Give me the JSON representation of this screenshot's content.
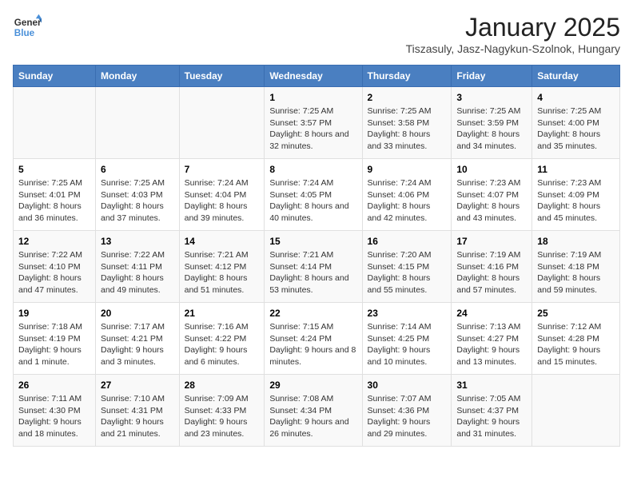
{
  "header": {
    "logo_line1": "General",
    "logo_line2": "Blue",
    "title": "January 2025",
    "subtitle": "Tiszasuly, Jasz-Nagykun-Szolnok, Hungary"
  },
  "days_of_week": [
    "Sunday",
    "Monday",
    "Tuesday",
    "Wednesday",
    "Thursday",
    "Friday",
    "Saturday"
  ],
  "weeks": [
    [
      {
        "day": "",
        "detail": ""
      },
      {
        "day": "",
        "detail": ""
      },
      {
        "day": "",
        "detail": ""
      },
      {
        "day": "1",
        "detail": "Sunrise: 7:25 AM\nSunset: 3:57 PM\nDaylight: 8 hours\nand 32 minutes."
      },
      {
        "day": "2",
        "detail": "Sunrise: 7:25 AM\nSunset: 3:58 PM\nDaylight: 8 hours\nand 33 minutes."
      },
      {
        "day": "3",
        "detail": "Sunrise: 7:25 AM\nSunset: 3:59 PM\nDaylight: 8 hours\nand 34 minutes."
      },
      {
        "day": "4",
        "detail": "Sunrise: 7:25 AM\nSunset: 4:00 PM\nDaylight: 8 hours\nand 35 minutes."
      }
    ],
    [
      {
        "day": "5",
        "detail": "Sunrise: 7:25 AM\nSunset: 4:01 PM\nDaylight: 8 hours\nand 36 minutes."
      },
      {
        "day": "6",
        "detail": "Sunrise: 7:25 AM\nSunset: 4:03 PM\nDaylight: 8 hours\nand 37 minutes."
      },
      {
        "day": "7",
        "detail": "Sunrise: 7:24 AM\nSunset: 4:04 PM\nDaylight: 8 hours\nand 39 minutes."
      },
      {
        "day": "8",
        "detail": "Sunrise: 7:24 AM\nSunset: 4:05 PM\nDaylight: 8 hours\nand 40 minutes."
      },
      {
        "day": "9",
        "detail": "Sunrise: 7:24 AM\nSunset: 4:06 PM\nDaylight: 8 hours\nand 42 minutes."
      },
      {
        "day": "10",
        "detail": "Sunrise: 7:23 AM\nSunset: 4:07 PM\nDaylight: 8 hours\nand 43 minutes."
      },
      {
        "day": "11",
        "detail": "Sunrise: 7:23 AM\nSunset: 4:09 PM\nDaylight: 8 hours\nand 45 minutes."
      }
    ],
    [
      {
        "day": "12",
        "detail": "Sunrise: 7:22 AM\nSunset: 4:10 PM\nDaylight: 8 hours\nand 47 minutes."
      },
      {
        "day": "13",
        "detail": "Sunrise: 7:22 AM\nSunset: 4:11 PM\nDaylight: 8 hours\nand 49 minutes."
      },
      {
        "day": "14",
        "detail": "Sunrise: 7:21 AM\nSunset: 4:12 PM\nDaylight: 8 hours\nand 51 minutes."
      },
      {
        "day": "15",
        "detail": "Sunrise: 7:21 AM\nSunset: 4:14 PM\nDaylight: 8 hours\nand 53 minutes."
      },
      {
        "day": "16",
        "detail": "Sunrise: 7:20 AM\nSunset: 4:15 PM\nDaylight: 8 hours\nand 55 minutes."
      },
      {
        "day": "17",
        "detail": "Sunrise: 7:19 AM\nSunset: 4:16 PM\nDaylight: 8 hours\nand 57 minutes."
      },
      {
        "day": "18",
        "detail": "Sunrise: 7:19 AM\nSunset: 4:18 PM\nDaylight: 8 hours\nand 59 minutes."
      }
    ],
    [
      {
        "day": "19",
        "detail": "Sunrise: 7:18 AM\nSunset: 4:19 PM\nDaylight: 9 hours\nand 1 minute."
      },
      {
        "day": "20",
        "detail": "Sunrise: 7:17 AM\nSunset: 4:21 PM\nDaylight: 9 hours\nand 3 minutes."
      },
      {
        "day": "21",
        "detail": "Sunrise: 7:16 AM\nSunset: 4:22 PM\nDaylight: 9 hours\nand 6 minutes."
      },
      {
        "day": "22",
        "detail": "Sunrise: 7:15 AM\nSunset: 4:24 PM\nDaylight: 9 hours\nand 8 minutes."
      },
      {
        "day": "23",
        "detail": "Sunrise: 7:14 AM\nSunset: 4:25 PM\nDaylight: 9 hours\nand 10 minutes."
      },
      {
        "day": "24",
        "detail": "Sunrise: 7:13 AM\nSunset: 4:27 PM\nDaylight: 9 hours\nand 13 minutes."
      },
      {
        "day": "25",
        "detail": "Sunrise: 7:12 AM\nSunset: 4:28 PM\nDaylight: 9 hours\nand 15 minutes."
      }
    ],
    [
      {
        "day": "26",
        "detail": "Sunrise: 7:11 AM\nSunset: 4:30 PM\nDaylight: 9 hours\nand 18 minutes."
      },
      {
        "day": "27",
        "detail": "Sunrise: 7:10 AM\nSunset: 4:31 PM\nDaylight: 9 hours\nand 21 minutes."
      },
      {
        "day": "28",
        "detail": "Sunrise: 7:09 AM\nSunset: 4:33 PM\nDaylight: 9 hours\nand 23 minutes."
      },
      {
        "day": "29",
        "detail": "Sunrise: 7:08 AM\nSunset: 4:34 PM\nDaylight: 9 hours\nand 26 minutes."
      },
      {
        "day": "30",
        "detail": "Sunrise: 7:07 AM\nSunset: 4:36 PM\nDaylight: 9 hours\nand 29 minutes."
      },
      {
        "day": "31",
        "detail": "Sunrise: 7:05 AM\nSunset: 4:37 PM\nDaylight: 9 hours\nand 31 minutes."
      },
      {
        "day": "",
        "detail": ""
      }
    ]
  ]
}
